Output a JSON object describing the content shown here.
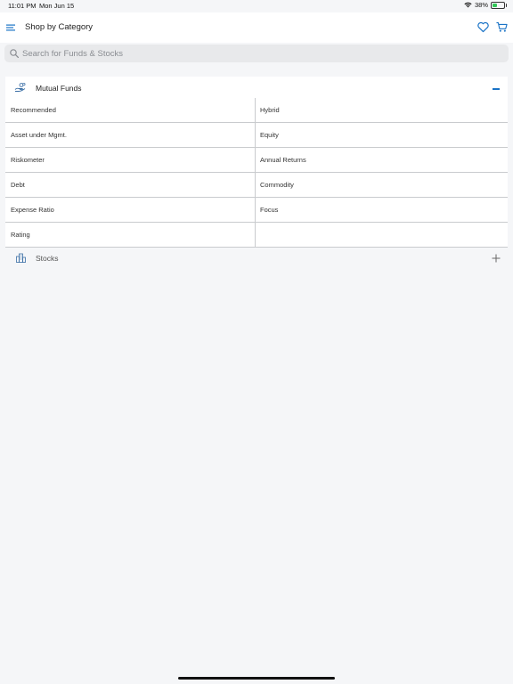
{
  "status_bar": {
    "time": "11:01 PM",
    "date": "Mon Jun 15",
    "battery": "38%",
    "battery_level": 0.38
  },
  "header": {
    "title": "Shop by Category"
  },
  "search": {
    "placeholder": "Search for Funds & Stocks"
  },
  "mutual_funds": {
    "title": "Mutual Funds",
    "rows": [
      {
        "left": "Recommended",
        "right": "Hybrid"
      },
      {
        "left": "Asset under Mgmt.",
        "right": "Equity"
      },
      {
        "left": "Riskometer",
        "right": "Annual Returns"
      },
      {
        "left": "Debt",
        "right": "Commodity"
      },
      {
        "left": "Expense Ratio",
        "right": "Focus"
      },
      {
        "left": "Rating",
        "right": ""
      }
    ]
  },
  "stocks": {
    "title": "Stocks"
  },
  "colors": {
    "accent": "#1a73c6",
    "background": "#f5f6f8",
    "battery_fill": "#34c759"
  }
}
